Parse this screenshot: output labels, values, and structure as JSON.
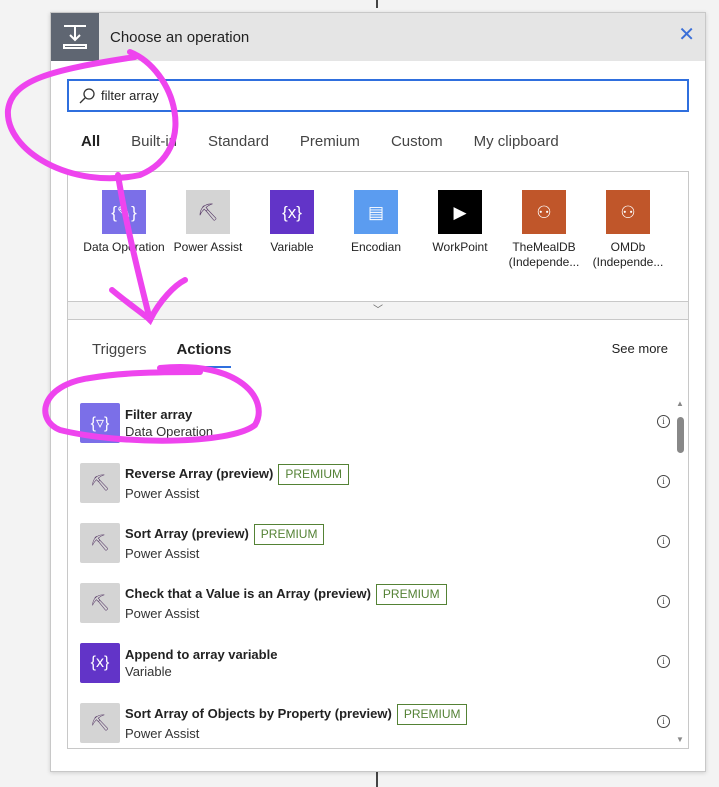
{
  "header": {
    "title": "Choose an operation",
    "close_icon": "close-icon"
  },
  "search": {
    "value": "filter array",
    "placeholder": ""
  },
  "filter_tabs": [
    {
      "label": "All",
      "active": true
    },
    {
      "label": "Built-in"
    },
    {
      "label": "Standard"
    },
    {
      "label": "Premium"
    },
    {
      "label": "Custom"
    },
    {
      "label": "My clipboard"
    }
  ],
  "connectors": [
    {
      "label": "Data Operation",
      "color": "#7b6fe8"
    },
    {
      "label": "Power Assist",
      "color": "#d4d4d4"
    },
    {
      "label": "Variable",
      "color": "#6234c8"
    },
    {
      "label": "Encodian",
      "color": "#5b9cf0"
    },
    {
      "label": "WorkPoint",
      "color": "#000000"
    },
    {
      "label": "TheMealDB (Independe...",
      "color": "#c0562a"
    },
    {
      "label": "OMDb (Independe...",
      "color": "#c0562a"
    }
  ],
  "action_tabs": {
    "triggers": "Triggers",
    "actions": "Actions",
    "see_more": "See more"
  },
  "actions": [
    {
      "title": "Filter array",
      "subtitle": "Data Operation",
      "badge": ""
    },
    {
      "title": "Reverse Array (preview)",
      "subtitle": "Power Assist",
      "badge": "PREMIUM"
    },
    {
      "title": "Sort Array (preview)",
      "subtitle": "Power Assist",
      "badge": "PREMIUM"
    },
    {
      "title": "Check that a Value is an Array (preview)",
      "subtitle": "Power Assist",
      "badge": "PREMIUM"
    },
    {
      "title": "Append to array variable",
      "subtitle": "Variable",
      "badge": ""
    },
    {
      "title": "Sort Array of Objects by Property (preview)",
      "subtitle": "Power Assist",
      "badge": "PREMIUM"
    }
  ],
  "colors": {
    "accent": "#2f6fde",
    "premium": "#548235",
    "annotation": "#ee44ee"
  }
}
